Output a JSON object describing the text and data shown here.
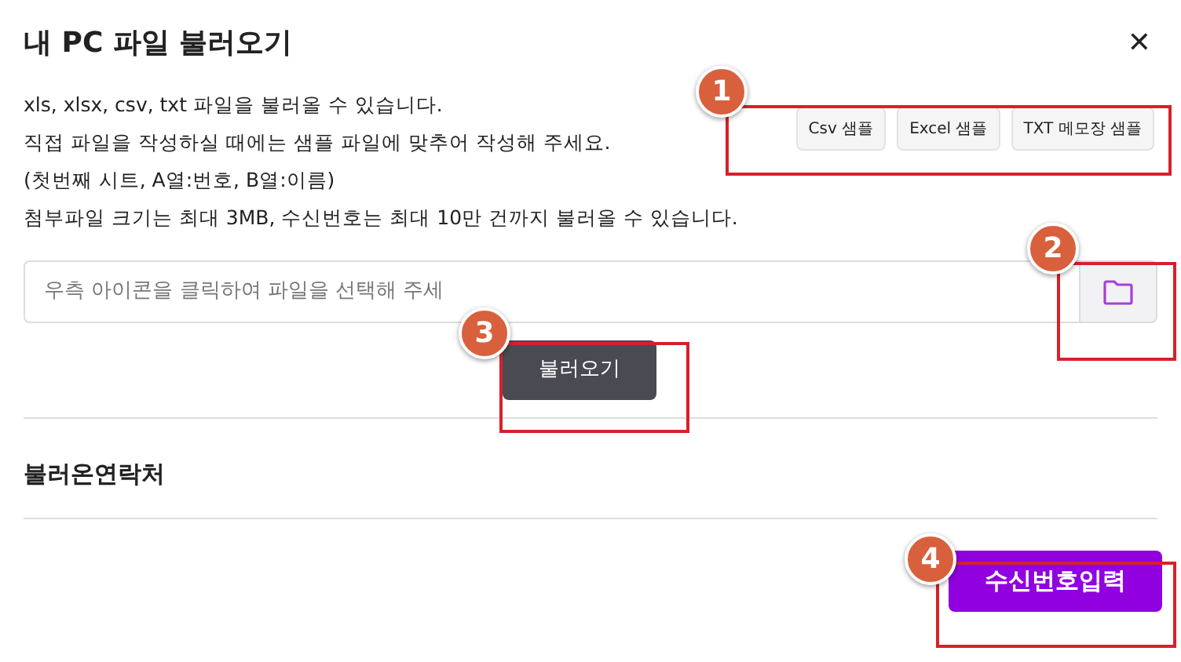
{
  "dialog": {
    "title": "내 PC 파일 불러오기",
    "close": "✕"
  },
  "description": [
    "xls, xlsx, csv, txt 파일을 불러올 수 있습니다.",
    "직접 파일을 작성하실 때에는 샘플 파일에 맞추어 작성해 주세요.",
    "(첫번째 시트, A열:번호, B열:이름)",
    "첨부파일 크기는 최대 3MB, 수신번호는 최대 10만 건까지 불러올 수 있습니다."
  ],
  "sample_buttons": [
    "Csv 샘플",
    "Excel 샘플",
    "TXT 메모장 샘플"
  ],
  "file_field": {
    "placeholder": "우측 아이콘을 클릭하여 파일을 선택해 주세"
  },
  "load_button": "불러오기",
  "section_title": "불러온연락처",
  "submit_button": "수신번호입력",
  "annotations": [
    {
      "number": "1"
    },
    {
      "number": "2"
    },
    {
      "number": "3"
    },
    {
      "number": "4"
    }
  ]
}
